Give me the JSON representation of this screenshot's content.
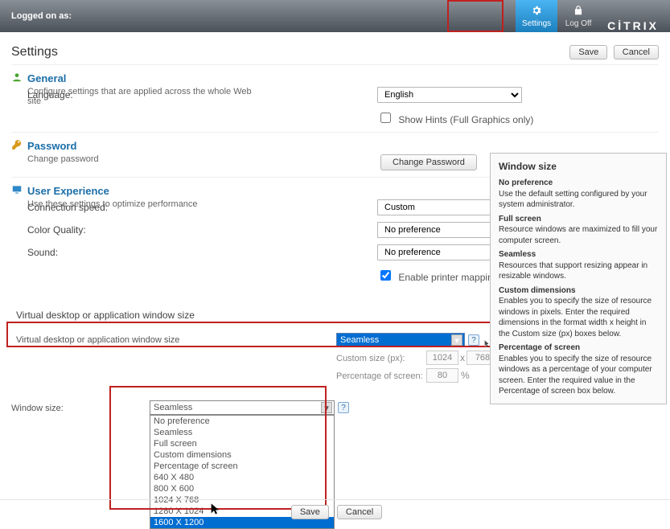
{
  "header": {
    "logged_label": "Logged on as:",
    "settings_label": "Settings",
    "logoff_label": "Log Off",
    "brand": "CİTRIX"
  },
  "page_title": "Settings",
  "top_buttons": {
    "save": "Save",
    "cancel": "Cancel"
  },
  "general": {
    "title": "General",
    "desc": "Configure settings that are applied across the whole Web site",
    "language_label": "Language:",
    "language_value": "English",
    "show_hints_label": "Show Hints (Full Graphics only)"
  },
  "password": {
    "title": "Password",
    "desc": "Change password",
    "button": "Change Password"
  },
  "user_experience": {
    "title": "User Experience",
    "desc": "Use these settings to optimize performance",
    "rows": {
      "conn_speed_label": "Connection speed:",
      "conn_speed_value": "Custom",
      "color_label": "Color Quality:",
      "color_value": "No preference",
      "sound_label": "Sound:",
      "sound_value": "No preference",
      "printer_label": "Enable printer mapping",
      "printer_checked": true
    }
  },
  "window_size_block": {
    "group_label": "Virtual desktop or application window size",
    "select_label": "Window size:",
    "select_value": "Seamless",
    "custom_label": "Custom size (px):",
    "custom_w": "1024",
    "custom_h": "768",
    "x": "x",
    "pct_label": "Percentage of screen:",
    "pct_value": "80",
    "pct_unit": "%"
  },
  "lower_block": {
    "label": "Window size:",
    "closed_value": "Seamless",
    "options": [
      "No preference",
      "Seamless",
      "Full screen",
      "Custom dimensions",
      "Percentage of screen",
      "640 X 480",
      "800 X 600",
      "1024 X 768",
      "1280 X 1024",
      "1600 X 1200"
    ],
    "selected_option": "1600 X 1200"
  },
  "tooltip": {
    "title": "Window size",
    "items": [
      {
        "h": "No preference",
        "t": "Use the default setting configured by your system administrator."
      },
      {
        "h": "Full screen",
        "t": "Resource windows are maximized to fill your computer screen."
      },
      {
        "h": "Seamless",
        "t": "Resources that support resizing appear in resizable windows."
      },
      {
        "h": "Custom dimensions",
        "t": "Enables you to specify the size of resource windows in pixels. Enter the required dimensions in the format width x height in the Custom size (px) boxes below."
      },
      {
        "h": "Percentage of screen",
        "t": "Enables you to specify the size of resource windows as a percentage of your computer screen. Enter the required value in the Percentage of screen box below."
      }
    ]
  },
  "footer": {
    "save": "Save",
    "cancel": "Cancel"
  }
}
